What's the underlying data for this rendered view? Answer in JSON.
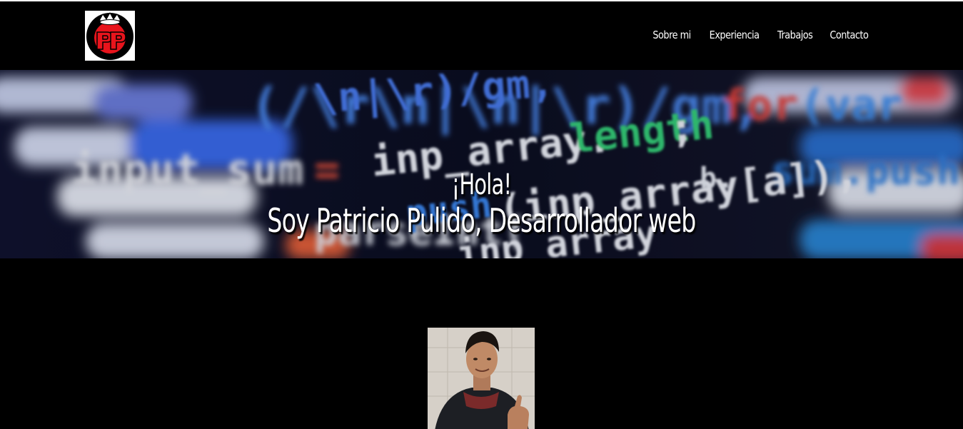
{
  "brand": {
    "logo_icon": "pp-crown-logo-icon",
    "logo_letters": "PP"
  },
  "nav": {
    "items": [
      {
        "label": "Sobre mi"
      },
      {
        "label": "Experiencia"
      },
      {
        "label": "Trabajos"
      },
      {
        "label": "Contacto"
      }
    ]
  },
  "hero": {
    "greeting": "¡Hola!",
    "subtitle": "Soy Patricio Pulido, Desarrollador web",
    "background_icon": "code-screen-background-image"
  },
  "profile": {
    "photo_icon": "profile-photo-image"
  },
  "colors": {
    "background": "#000000",
    "text": "#ffffff",
    "logo_red": "#e8141c"
  }
}
